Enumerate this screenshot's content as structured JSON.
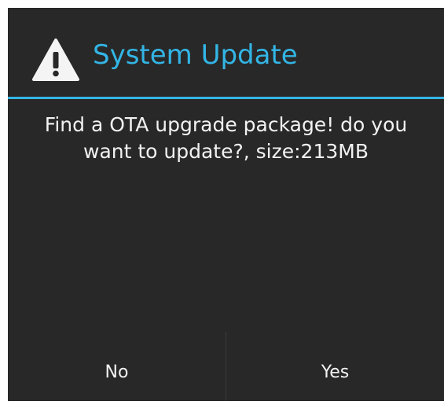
{
  "dialog": {
    "title": "System Update",
    "icon": "warning-icon",
    "message": "Find a OTA upgrade package! do you\nwant to update?, size:213MB",
    "buttons": {
      "no_label": "No",
      "yes_label": "Yes"
    }
  },
  "colors": {
    "background": "#282828",
    "accent": "#33b5e5",
    "text": "#f2f2f2"
  }
}
